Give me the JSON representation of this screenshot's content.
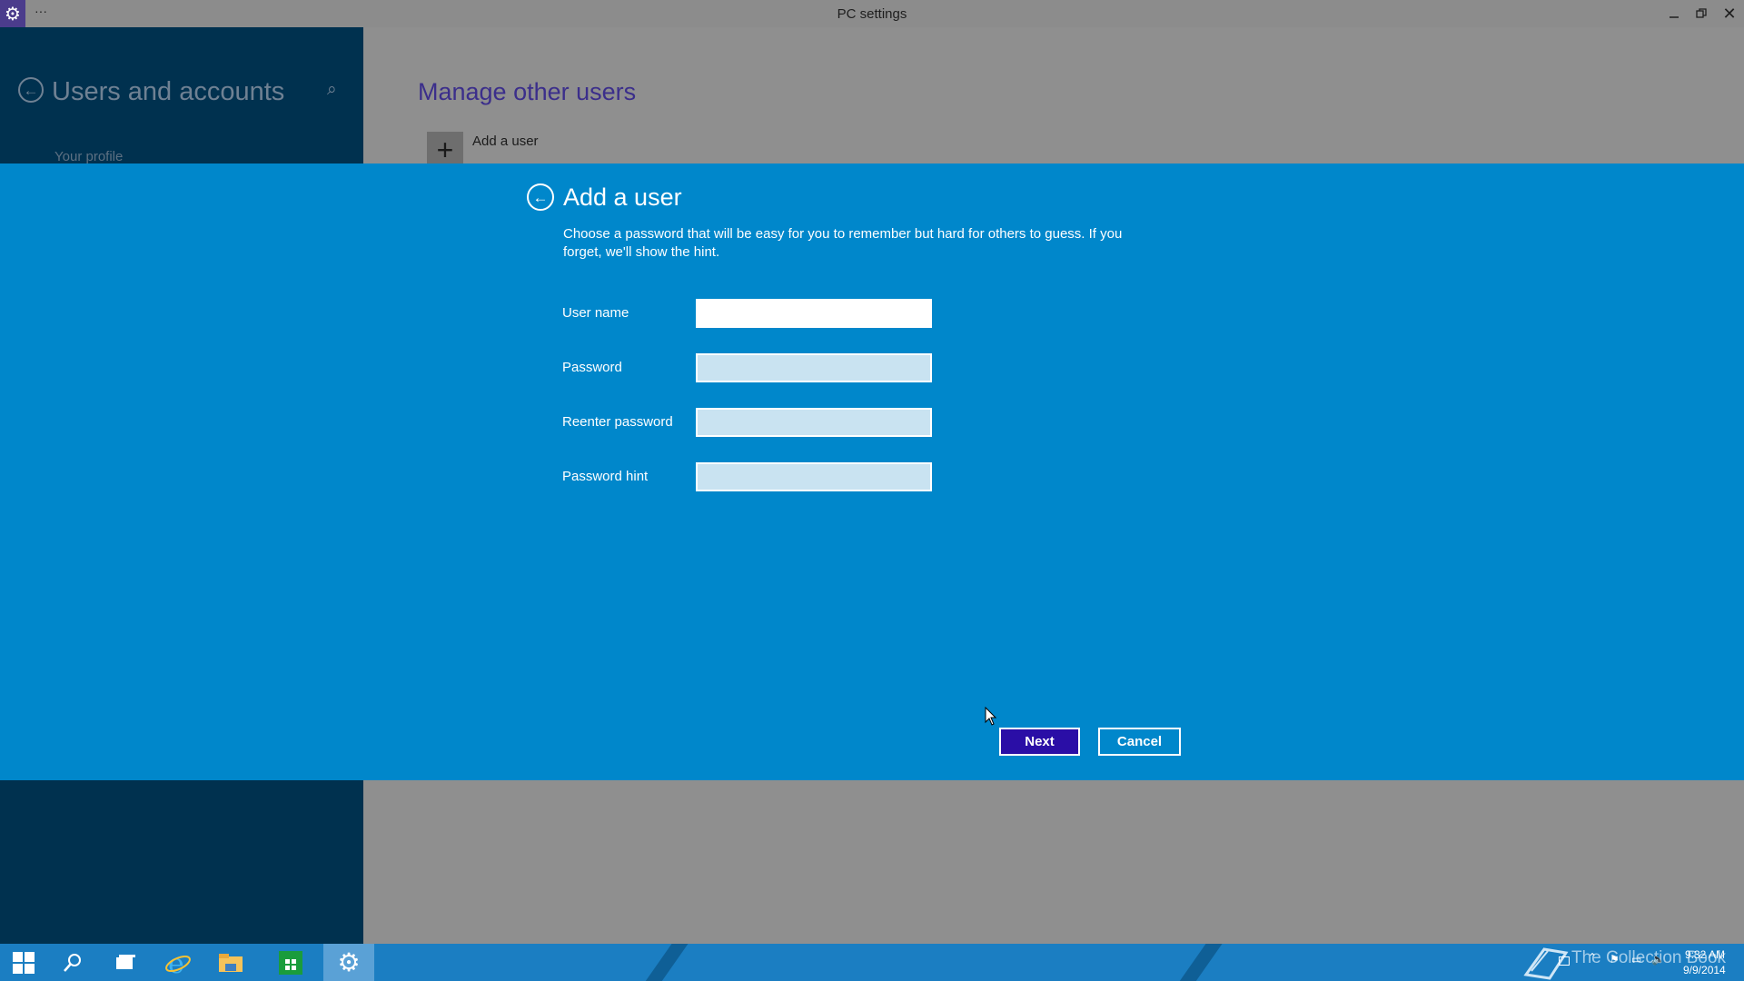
{
  "window": {
    "title": "PC settings",
    "menu_glyph": "···",
    "app_icon": "gear-icon",
    "buttons": {
      "minimize": "minimize-icon",
      "maximize": "restore-icon",
      "close": "close-icon"
    }
  },
  "sidebar": {
    "heading": "Users and accounts",
    "items": [
      {
        "label": "Your profile"
      }
    ]
  },
  "main": {
    "heading": "Manage other users",
    "add_user_label": "Add a user"
  },
  "dialog": {
    "title": "Add a user",
    "description": "Choose a password that will be easy for you to remember but hard for others to guess. If you forget, we'll show the hint.",
    "fields": [
      {
        "label": "User name",
        "value": ""
      },
      {
        "label": "Password",
        "value": ""
      },
      {
        "label": "Reenter password",
        "value": ""
      },
      {
        "label": "Password hint",
        "value": ""
      }
    ],
    "next_label": "Next",
    "cancel_label": "Cancel"
  },
  "taskbar": {
    "apps": [
      "start-icon",
      "search-icon",
      "task-view-icon",
      "internet-explorer-icon",
      "file-explorer-icon",
      "store-icon",
      "settings-icon"
    ],
    "watermark": "The Collection Book",
    "time": "9:32 AM",
    "date": "9/9/2014"
  },
  "colors": {
    "accent": "#0087cb",
    "sidebar": "#00314f",
    "next_button": "#2a0ea6",
    "heading": "#3b2e8b"
  }
}
